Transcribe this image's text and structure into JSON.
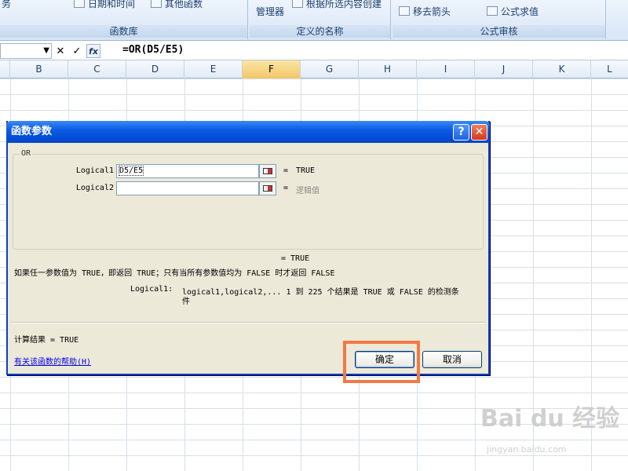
{
  "ribbon": {
    "partial_left_label": "务",
    "datetime_label": "日期和时间",
    "other_functions_label": "其他函数",
    "group_function_library": "函数库",
    "name_manager_label": "管理器",
    "create_from_selection_label": "根据所选内容创建",
    "group_defined_names": "定义的名称",
    "move_arrows_label": "移去箭头",
    "evaluate_formula_label": "公式求值",
    "group_formula_auditing": "公式审核"
  },
  "formula_bar": {
    "cancel_symbol": "✕",
    "enter_symbol": "✓",
    "fx_symbol": "fx",
    "formula": "=OR(D5/E5)"
  },
  "columns": [
    "B",
    "C",
    "D",
    "E",
    "F",
    "G",
    "H",
    "I",
    "J",
    "K",
    "L"
  ],
  "selected_column": "F",
  "dialog": {
    "title": "函数参数",
    "help_button": "?",
    "close_button": "✕",
    "function_name": "OR",
    "args": [
      {
        "label": "Logical1",
        "value": "D5/E5",
        "result": "TRUE"
      },
      {
        "label": "Logical2",
        "value": "",
        "result": "逻辑值"
      }
    ],
    "equals": "=",
    "overall_result": "= TRUE",
    "description": "如果任一参数值为 TRUE，即返回 TRUE；只有当所有参数值均为 FALSE 时才返回 FALSE",
    "arg_help_name": "Logical1:",
    "arg_help_text_line1": "logical1,logical2,... 1 到 225 个结果是 TRUE 或 FALSE 的检测条",
    "arg_help_text_line2": "件",
    "calc_result": "计算结果 = TRUE",
    "help_link": "有关该函数的帮助(H)",
    "ok_button": "确定",
    "cancel_button": "取消"
  },
  "watermark": {
    "brand": "Bai du 经验",
    "url": "jingyan.baidu.com"
  }
}
